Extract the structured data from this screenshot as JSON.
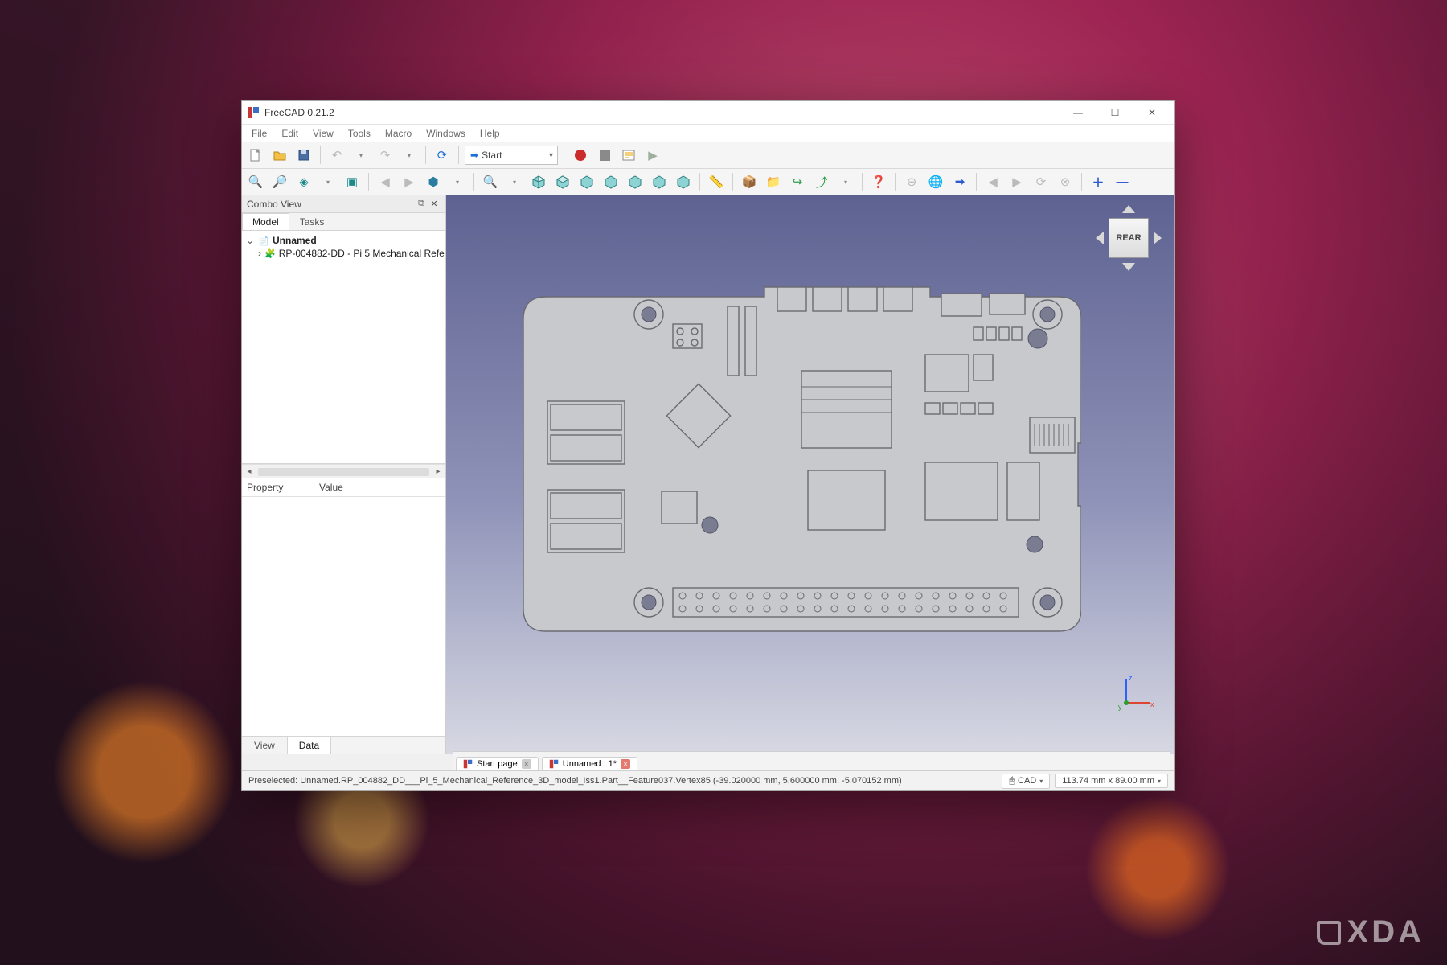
{
  "window": {
    "title": "FreeCAD 0.21.2"
  },
  "menu": [
    "File",
    "Edit",
    "View",
    "Tools",
    "Macro",
    "Windows",
    "Help"
  ],
  "workbench": {
    "label": "Start"
  },
  "comboView": {
    "title": "Combo View",
    "tabs": {
      "model": "Model",
      "tasks": "Tasks"
    },
    "tree": {
      "root": "Unnamed",
      "child": "RP-004882-DD - Pi 5 Mechanical Refe"
    },
    "property_hdr": {
      "c1": "Property",
      "c2": "Value"
    },
    "bottomTabs": {
      "view": "View",
      "data": "Data"
    }
  },
  "navcube": {
    "face": "REAR"
  },
  "docTabs": {
    "start": "Start page",
    "doc": "Unnamed : 1*"
  },
  "status": {
    "msg": "Preselected: Unnamed.RP_004882_DD___Pi_5_Mechanical_Reference_3D_model_Iss1.Part__Feature037.Vertex85 (-39.020000 mm, 5.600000 mm, -5.070152 mm)",
    "mode": "CAD",
    "dims": "113.74 mm x 89.00 mm"
  },
  "watermark": "XDA"
}
